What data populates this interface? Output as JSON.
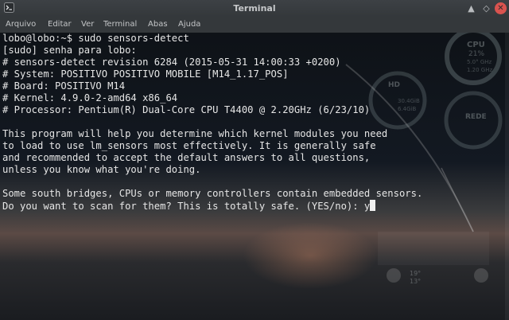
{
  "window": {
    "title": "Terminal"
  },
  "menu": [
    "Arquivo",
    "Editar",
    "Ver",
    "Terminal",
    "Abas",
    "Ajuda"
  ],
  "terminal": {
    "lines": [
      "lobo@lobo:~$ sudo sensors-detect",
      "[sudo] senha para lobo:",
      "# sensors-detect revision 6284 (2015-05-31 14:00:33 +0200)",
      "# System: POSITIVO POSITIVO MOBILE [M14_1.17_POS]",
      "# Board: POSITIVO M14",
      "# Kernel: 4.9.0-2-amd64 x86_64",
      "# Processor: Pentium(R) Dual-Core CPU T4400 @ 2.20GHz (6/23/10)",
      "",
      "This program will help you determine which kernel modules you need",
      "to load to use lm_sensors most effectively. It is generally safe",
      "and recommended to accept the default answers to all questions,",
      "unless you know what you're doing.",
      "",
      "Some south bridges, CPUs or memory controllers contain embedded sensors.",
      "Do you want to scan for them? This is totally safe. (YES/no): y"
    ]
  },
  "desktop_widget": {
    "cpu_label": "CPU",
    "cpu_value": "21%",
    "cpu_detail_1": "5.0° GHz",
    "cpu_detail_2": "1.20 GHz",
    "hd_label": "HD",
    "hd_value_1": "30.4GiB",
    "hd_value_2": "6.4GiB",
    "rede_label": "REDE",
    "temp": "19°",
    "temp_2": "13°"
  }
}
